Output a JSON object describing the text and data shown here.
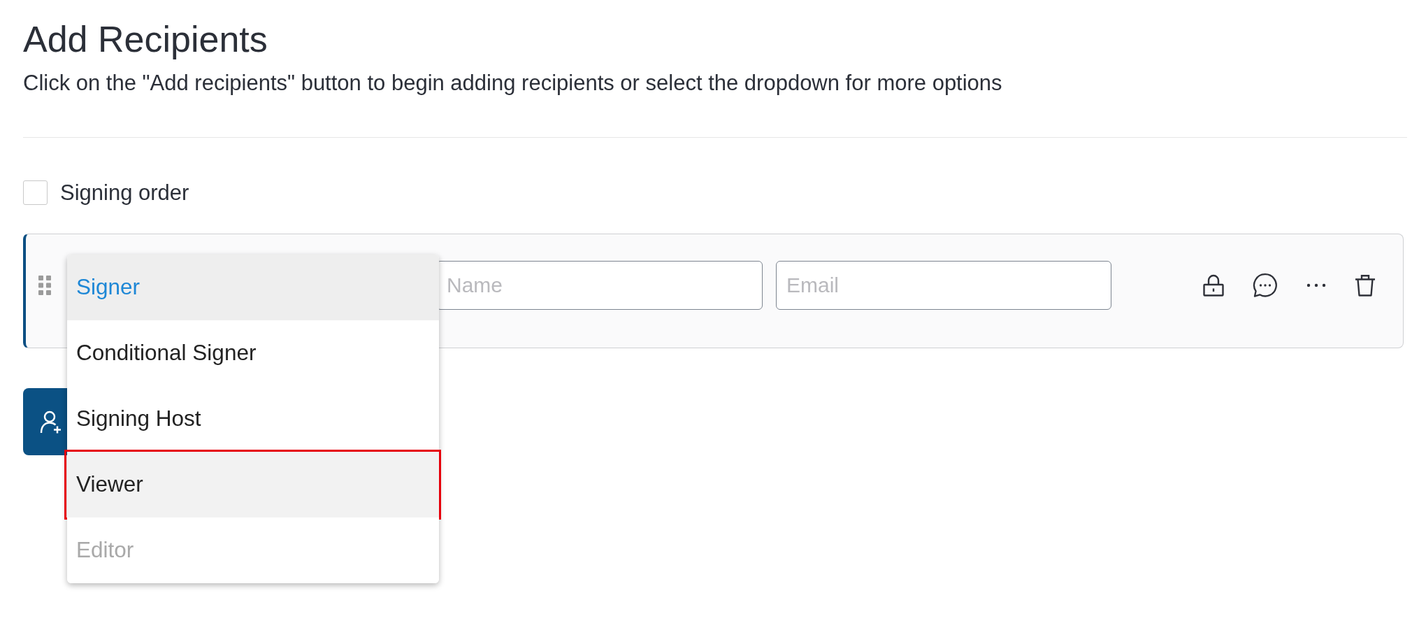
{
  "header": {
    "title": "Add Recipients",
    "subtitle": "Click on the \"Add recipients\" button to begin adding recipients or select the dropdown for more options"
  },
  "signing_order": {
    "label": "Signing order",
    "checked": false
  },
  "recipients": [
    {
      "name": {
        "placeholder": "Name"
      },
      "email": {
        "placeholder": "Email"
      },
      "role_menu": {
        "items": [
          {
            "label": "Signer",
            "selected": true,
            "hovered": false,
            "disabled": false,
            "outlined": false
          },
          {
            "label": "Conditional Signer",
            "selected": false,
            "hovered": false,
            "disabled": false,
            "outlined": false
          },
          {
            "label": "Signing Host",
            "selected": false,
            "hovered": false,
            "disabled": false,
            "outlined": false
          },
          {
            "label": "Viewer",
            "selected": false,
            "hovered": true,
            "disabled": false,
            "outlined": true
          },
          {
            "label": "Editor",
            "selected": false,
            "hovered": false,
            "disabled": true,
            "outlined": false
          }
        ]
      }
    }
  ]
}
